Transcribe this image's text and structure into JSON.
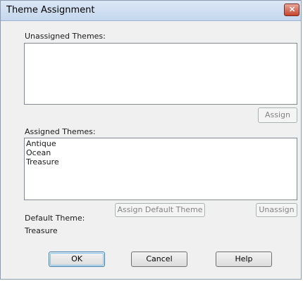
{
  "window": {
    "title": "Theme Assignment",
    "close_glyph": "✕"
  },
  "unassigned": {
    "label": "Unassigned Themes:",
    "items": []
  },
  "assign_button": "Assign",
  "assigned": {
    "label": "Assigned Themes:",
    "items": [
      "Antique",
      "Ocean",
      "Treasure"
    ]
  },
  "assign_default_button": "Assign Default Theme",
  "unassign_button": "Unassign",
  "default_theme": {
    "label": "Default Theme:",
    "value": "Treasure"
  },
  "footer": {
    "ok": "OK",
    "cancel": "Cancel",
    "help": "Help"
  },
  "colors": {
    "titlebar": "#c5d7ee",
    "close": "#c4442f",
    "dialog_bg": "#f0f0f0"
  }
}
